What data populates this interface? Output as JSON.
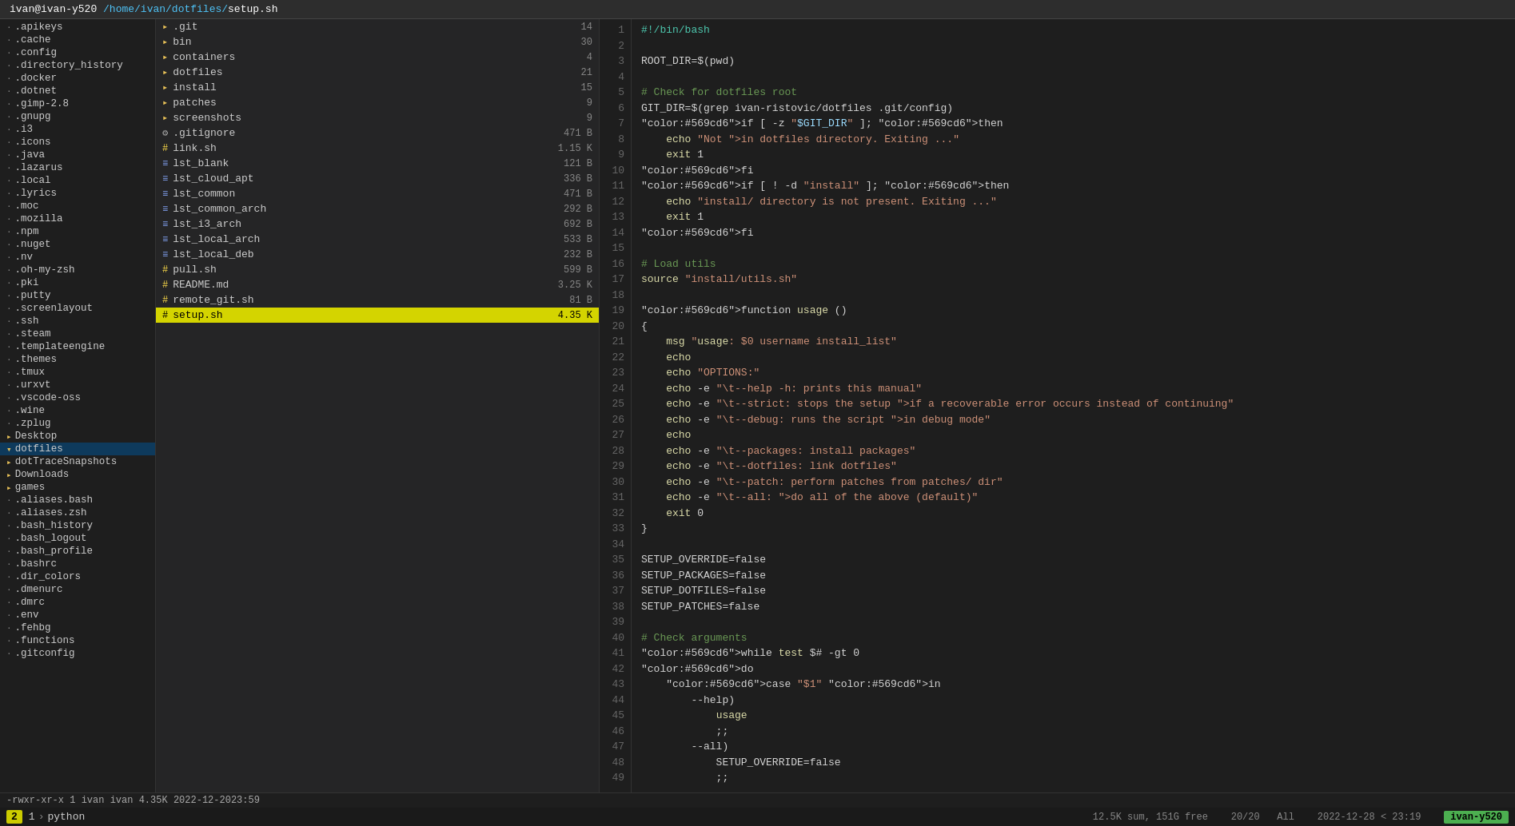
{
  "titleBar": {
    "user": "ivan@ivan-y520",
    "path": "/home/ivan/dotfiles/",
    "file": "setup.sh"
  },
  "leftPanel": {
    "items": [
      {
        "icon": "dot-file",
        "name": ".apikeys",
        "type": "file"
      },
      {
        "icon": "dot-file",
        "name": ".cache",
        "type": "file"
      },
      {
        "icon": "dot-file",
        "name": ".config",
        "type": "file"
      },
      {
        "icon": "dot-file",
        "name": ".directory_history",
        "type": "file"
      },
      {
        "icon": "dot-file",
        "name": ".docker",
        "type": "file"
      },
      {
        "icon": "dot-file",
        "name": ".dotnet",
        "type": "file"
      },
      {
        "icon": "dot-file",
        "name": ".gimp-2.8",
        "type": "file"
      },
      {
        "icon": "dot-file",
        "name": ".gnupg",
        "type": "file"
      },
      {
        "icon": "dot-file",
        "name": ".i3",
        "type": "file"
      },
      {
        "icon": "dot-file",
        "name": ".icons",
        "type": "file"
      },
      {
        "icon": "dot-file",
        "name": ".java",
        "type": "file"
      },
      {
        "icon": "dot-file",
        "name": ".lazarus",
        "type": "file"
      },
      {
        "icon": "dot-file",
        "name": ".local",
        "type": "file"
      },
      {
        "icon": "dot-file",
        "name": ".lyrics",
        "type": "file"
      },
      {
        "icon": "dot-file",
        "name": ".moc",
        "type": "file"
      },
      {
        "icon": "dot-file",
        "name": ".mozilla",
        "type": "file"
      },
      {
        "icon": "dot-file",
        "name": ".npm",
        "type": "file"
      },
      {
        "icon": "dot-file",
        "name": ".nuget",
        "type": "file"
      },
      {
        "icon": "dot-file",
        "name": ".nv",
        "type": "file"
      },
      {
        "icon": "dot-file",
        "name": ".oh-my-zsh",
        "type": "file"
      },
      {
        "icon": "dot-file",
        "name": ".pki",
        "type": "file"
      },
      {
        "icon": "dot-file",
        "name": ".putty",
        "type": "file"
      },
      {
        "icon": "dot-file",
        "name": ".screenlayout",
        "type": "file"
      },
      {
        "icon": "dot-file",
        "name": ".ssh",
        "type": "file"
      },
      {
        "icon": "dot-file",
        "name": ".steam",
        "type": "file"
      },
      {
        "icon": "dot-file",
        "name": ".templateengine",
        "type": "file"
      },
      {
        "icon": "dot-file",
        "name": ".themes",
        "type": "file"
      },
      {
        "icon": "dot-file",
        "name": ".tmux",
        "type": "file"
      },
      {
        "icon": "dot-file",
        "name": ".urxvt",
        "type": "file"
      },
      {
        "icon": "dot-file",
        "name": ".vscode-oss",
        "type": "file"
      },
      {
        "icon": "dot-file",
        "name": ".wine",
        "type": "file"
      },
      {
        "icon": "dot-file",
        "name": ".zplug",
        "type": "file"
      },
      {
        "icon": "folder",
        "name": "Desktop",
        "type": "folder"
      },
      {
        "icon": "folder",
        "name": "dotfiles",
        "type": "folder",
        "active": true
      },
      {
        "icon": "folder",
        "name": "dotTraceSnapshots",
        "type": "folder"
      },
      {
        "icon": "folder-open",
        "name": "Downloads",
        "type": "folder"
      },
      {
        "icon": "folder",
        "name": "games",
        "type": "folder"
      },
      {
        "icon": "dot-file",
        "name": ".aliases.bash",
        "type": "file"
      },
      {
        "icon": "dot-file",
        "name": ".aliases.zsh",
        "type": "file"
      },
      {
        "icon": "dot-file",
        "name": ".bash_history",
        "type": "file"
      },
      {
        "icon": "dot-file",
        "name": ".bash_logout",
        "type": "file"
      },
      {
        "icon": "dot-file",
        "name": ".bash_profile",
        "type": "file"
      },
      {
        "icon": "dot-file",
        "name": ".bashrc",
        "type": "file"
      },
      {
        "icon": "dot-file",
        "name": ".dir_colors",
        "type": "file"
      },
      {
        "icon": "dot-file",
        "name": ".dmenurc",
        "type": "file"
      },
      {
        "icon": "dot-file",
        "name": ".dmrc",
        "type": "file"
      },
      {
        "icon": "dot-file",
        "name": ".env",
        "type": "file"
      },
      {
        "icon": "dot-file",
        "name": ".fehbg",
        "type": "file"
      },
      {
        "icon": "dot-file",
        "name": ".functions",
        "type": "file"
      },
      {
        "icon": "dot-file",
        "name": ".gitconfig",
        "type": "file"
      }
    ]
  },
  "middlePanel": {
    "files": [
      {
        "icon": "folder",
        "name": ".git",
        "size": "14",
        "type": "folder"
      },
      {
        "icon": "folder",
        "name": "bin",
        "size": "30",
        "type": "folder"
      },
      {
        "icon": "folder",
        "name": "containers",
        "size": "4",
        "type": "folder"
      },
      {
        "icon": "folder",
        "name": "dotfiles",
        "size": "21",
        "type": "folder"
      },
      {
        "icon": "folder",
        "name": "install",
        "size": "15",
        "type": "folder"
      },
      {
        "icon": "folder",
        "name": "patches",
        "size": "9",
        "type": "folder"
      },
      {
        "icon": "folder",
        "name": "screenshots",
        "size": "9",
        "type": "folder"
      },
      {
        "icon": "gear",
        "name": ".gitignore",
        "size": "471 B",
        "type": "config"
      },
      {
        "icon": "hash",
        "name": "link.sh",
        "size": "1.15 K",
        "type": "script"
      },
      {
        "icon": "equals",
        "name": "lst_blank",
        "size": "121 B",
        "type": "list"
      },
      {
        "icon": "equals",
        "name": "lst_cloud_apt",
        "size": "336 B",
        "type": "list"
      },
      {
        "icon": "equals",
        "name": "lst_common",
        "size": "471 B",
        "type": "list"
      },
      {
        "icon": "equals",
        "name": "lst_common_arch",
        "size": "292 B",
        "type": "list"
      },
      {
        "icon": "equals",
        "name": "lst_i3_arch",
        "size": "692 B",
        "type": "list"
      },
      {
        "icon": "equals",
        "name": "lst_local_arch",
        "size": "533 B",
        "type": "list"
      },
      {
        "icon": "equals",
        "name": "lst_local_deb",
        "size": "232 B",
        "type": "list"
      },
      {
        "icon": "hash",
        "name": "pull.sh",
        "size": "599 B",
        "type": "script"
      },
      {
        "icon": "hash",
        "name": "README.md",
        "size": "3.25 K",
        "type": "doc"
      },
      {
        "icon": "hash",
        "name": "remote_git.sh",
        "size": "81 B",
        "type": "script"
      },
      {
        "icon": "hash",
        "name": "setup.sh",
        "size": "4.35 K",
        "type": "script",
        "selected": true
      }
    ]
  },
  "editor": {
    "lines": [
      {
        "num": 1,
        "content": "#!/bin/bash",
        "type": "shebang"
      },
      {
        "num": 2,
        "content": "",
        "type": "blank"
      },
      {
        "num": 3,
        "content": "ROOT_DIR=$(pwd)",
        "type": "code"
      },
      {
        "num": 4,
        "content": "",
        "type": "blank"
      },
      {
        "num": 5,
        "content": "# Check for dotfiles root",
        "type": "comment"
      },
      {
        "num": 6,
        "content": "GIT_DIR=$(grep ivan-ristovic/dotfiles .git/config)",
        "type": "code"
      },
      {
        "num": 7,
        "content": "if [ -z \"$GIT_DIR\" ]; then",
        "type": "code"
      },
      {
        "num": 8,
        "content": "    echo \"Not in dotfiles directory. Exiting ...\"",
        "type": "code"
      },
      {
        "num": 9,
        "content": "    exit 1",
        "type": "code"
      },
      {
        "num": 10,
        "content": "fi",
        "type": "code"
      },
      {
        "num": 11,
        "content": "if [ ! -d \"install\" ]; then",
        "type": "code"
      },
      {
        "num": 12,
        "content": "    echo \"install/ directory is not present. Exiting ...\"",
        "type": "code"
      },
      {
        "num": 13,
        "content": "    exit 1",
        "type": "code"
      },
      {
        "num": 14,
        "content": "fi",
        "type": "code"
      },
      {
        "num": 15,
        "content": "",
        "type": "blank"
      },
      {
        "num": 16,
        "content": "# Load utils",
        "type": "comment"
      },
      {
        "num": 17,
        "content": "source \"install/utils.sh\"",
        "type": "code"
      },
      {
        "num": 18,
        "content": "",
        "type": "blank"
      },
      {
        "num": 19,
        "content": "function usage ()",
        "type": "code"
      },
      {
        "num": 20,
        "content": "{",
        "type": "code"
      },
      {
        "num": 21,
        "content": "    msg \"usage: $0 username install_list\"",
        "type": "code"
      },
      {
        "num": 22,
        "content": "    echo",
        "type": "code"
      },
      {
        "num": 23,
        "content": "    echo \"OPTIONS:\"",
        "type": "code"
      },
      {
        "num": 24,
        "content": "    echo -e \"\\t--help -h: prints this manual\"",
        "type": "code"
      },
      {
        "num": 25,
        "content": "    echo -e \"\\t--strict: stops the setup if a recoverable error occurs instead of continuing\"",
        "type": "code"
      },
      {
        "num": 26,
        "content": "    echo -e \"\\t--debug: runs the script in debug mode\"",
        "type": "code"
      },
      {
        "num": 27,
        "content": "    echo",
        "type": "code"
      },
      {
        "num": 28,
        "content": "    echo -e \"\\t--packages: install packages\"",
        "type": "code"
      },
      {
        "num": 29,
        "content": "    echo -e \"\\t--dotfiles: link dotfiles\"",
        "type": "code"
      },
      {
        "num": 30,
        "content": "    echo -e \"\\t--patch: perform patches from patches/ dir\"",
        "type": "code"
      },
      {
        "num": 31,
        "content": "    echo -e \"\\t--all: do all of the above (default)\"",
        "type": "code"
      },
      {
        "num": 32,
        "content": "    exit 0",
        "type": "code"
      },
      {
        "num": 33,
        "content": "}",
        "type": "code"
      },
      {
        "num": 34,
        "content": "",
        "type": "blank"
      },
      {
        "num": 35,
        "content": "SETUP_OVERRIDE=false",
        "type": "code"
      },
      {
        "num": 36,
        "content": "SETUP_PACKAGES=false",
        "type": "code"
      },
      {
        "num": 37,
        "content": "SETUP_DOTFILES=false",
        "type": "code"
      },
      {
        "num": 38,
        "content": "SETUP_PATCHES=false",
        "type": "code"
      },
      {
        "num": 39,
        "content": "",
        "type": "blank"
      },
      {
        "num": 40,
        "content": "# Check arguments",
        "type": "comment"
      },
      {
        "num": 41,
        "content": "while test $# -gt 0",
        "type": "code"
      },
      {
        "num": 42,
        "content": "do",
        "type": "code"
      },
      {
        "num": 43,
        "content": "    case \"$1\" in",
        "type": "code"
      },
      {
        "num": 44,
        "content": "        --help)",
        "type": "code"
      },
      {
        "num": 45,
        "content": "            usage",
        "type": "code"
      },
      {
        "num": 46,
        "content": "            ;;",
        "type": "code"
      },
      {
        "num": 47,
        "content": "        --all)",
        "type": "code"
      },
      {
        "num": 48,
        "content": "            SETUP_OVERRIDE=false",
        "type": "code"
      },
      {
        "num": 49,
        "content": "            ;;",
        "type": "code"
      }
    ]
  },
  "statusBar": {
    "permissions": "-rwxr-xr-x",
    "links": "1",
    "user": "ivan",
    "group": "ivan",
    "size": "4.35K",
    "date": "2022-12-20",
    "time": "23:59"
  },
  "bottomBar": {
    "tabNum": "2",
    "tabItems": [
      {
        "num": "1",
        "chevron": ">",
        "label": "python"
      }
    ],
    "rightText": "12.5K sum, 151G free",
    "position": "20/20",
    "scroll": "All",
    "datetime": "2022-12-28 < 23:19",
    "host": "ivan-y520"
  }
}
